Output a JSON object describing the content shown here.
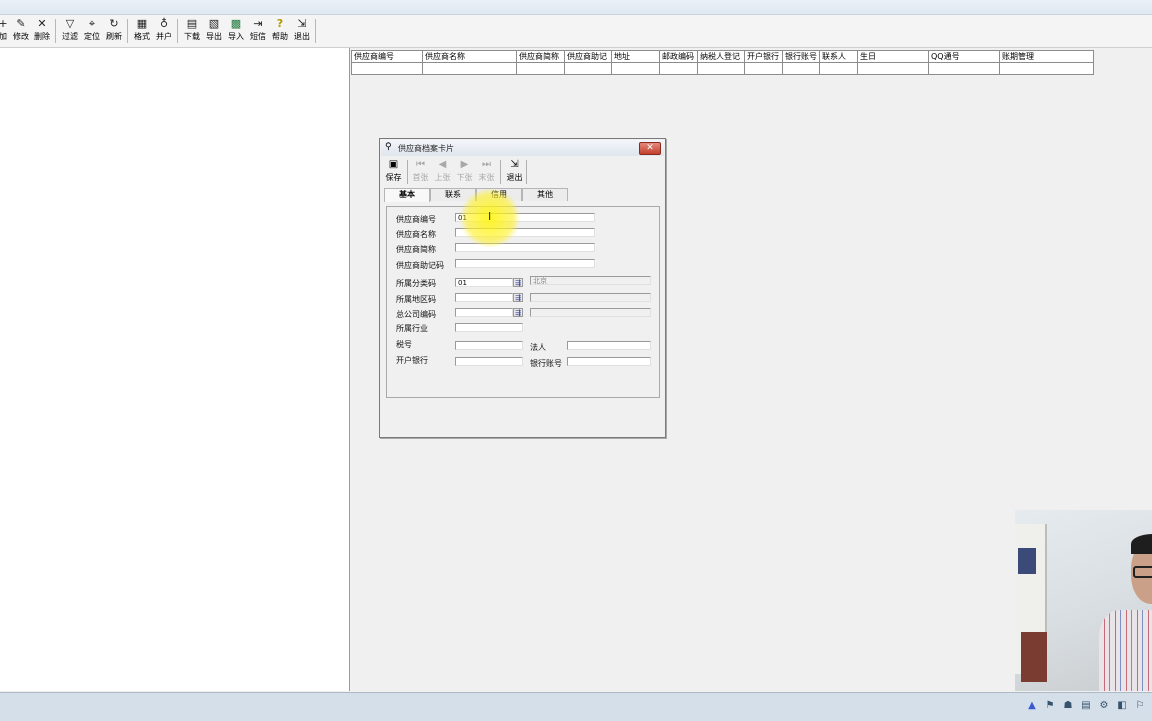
{
  "toolbar": {
    "items": [
      {
        "label": "加",
        "icon": "add-icon",
        "glyph": "+"
      },
      {
        "label": "修改",
        "icon": "edit-icon",
        "glyph": "✎"
      },
      {
        "label": "删除",
        "icon": "delete-icon",
        "glyph": "✕"
      },
      {
        "label": "过滤",
        "icon": "filter-icon",
        "glyph": "▽"
      },
      {
        "label": "定位",
        "icon": "locate-icon",
        "glyph": "⌖"
      },
      {
        "label": "刷新",
        "icon": "refresh-icon",
        "glyph": "↻"
      },
      {
        "label": "格式",
        "icon": "format-icon",
        "glyph": "▦"
      },
      {
        "label": "并户",
        "icon": "merge-icon",
        "glyph": "♁"
      },
      {
        "label": "下载",
        "icon": "download-icon",
        "glyph": "▤"
      },
      {
        "label": "导出",
        "icon": "export-icon",
        "glyph": "▧"
      },
      {
        "label": "导入",
        "icon": "import-icon",
        "glyph": "▩"
      },
      {
        "label": "短信",
        "icon": "sms-icon",
        "glyph": "⇥"
      },
      {
        "label": "帮助",
        "icon": "help-icon",
        "glyph": "?"
      },
      {
        "label": "退出",
        "icon": "exit-icon",
        "glyph": "⇲"
      }
    ]
  },
  "grid": {
    "headers": [
      "供应商编号",
      "供应商名称",
      "供应商简称",
      "供应商助记",
      "地址",
      "邮政编码",
      "纳税人登记",
      "开户银行",
      "银行账号",
      "联系人",
      "生日",
      "QQ通号",
      "账期管理"
    ]
  },
  "dialog": {
    "title": "供应商档案卡片",
    "toolbar": [
      {
        "label": "保存",
        "icon": "save-icon",
        "glyph": "▣",
        "disabled": false
      },
      {
        "label": "首张",
        "icon": "first-record-icon",
        "glyph": "⏮",
        "disabled": true
      },
      {
        "label": "上张",
        "icon": "prev-record-icon",
        "glyph": "◀",
        "disabled": true
      },
      {
        "label": "下张",
        "icon": "next-record-icon",
        "glyph": "▶",
        "disabled": true
      },
      {
        "label": "末张",
        "icon": "last-record-icon",
        "glyph": "⏭",
        "disabled": true
      },
      {
        "label": "退出",
        "icon": "exit-icon",
        "glyph": "⇲",
        "disabled": false
      }
    ],
    "tabs": [
      "基本",
      "联系",
      "信用",
      "其他"
    ],
    "fields": {
      "code_label": "供应商编号",
      "code_value": "01",
      "name_label": "供应商名称",
      "name_value": "",
      "short_label": "供应商简称",
      "short_value": "",
      "mnemonic_label": "供应商助记码",
      "mnemonic_value": "",
      "category_label": "所属分类码",
      "category_value": "01",
      "category_name": "北京",
      "region_label": "所属地区码",
      "region_value": "",
      "region_name": "",
      "hq_label": "总公司编码",
      "hq_value": "",
      "hq_name": "",
      "industry_label": "所属行业",
      "industry_value": "",
      "tax_label": "税号",
      "tax_value": "",
      "legal_label": "法人",
      "legal_value": "",
      "bank_label": "开户银行",
      "bank_value": "",
      "account_label": "银行账号",
      "account_value": ""
    }
  },
  "colors": {
    "highlight": "#fff200",
    "close_button": "#c2402d"
  }
}
